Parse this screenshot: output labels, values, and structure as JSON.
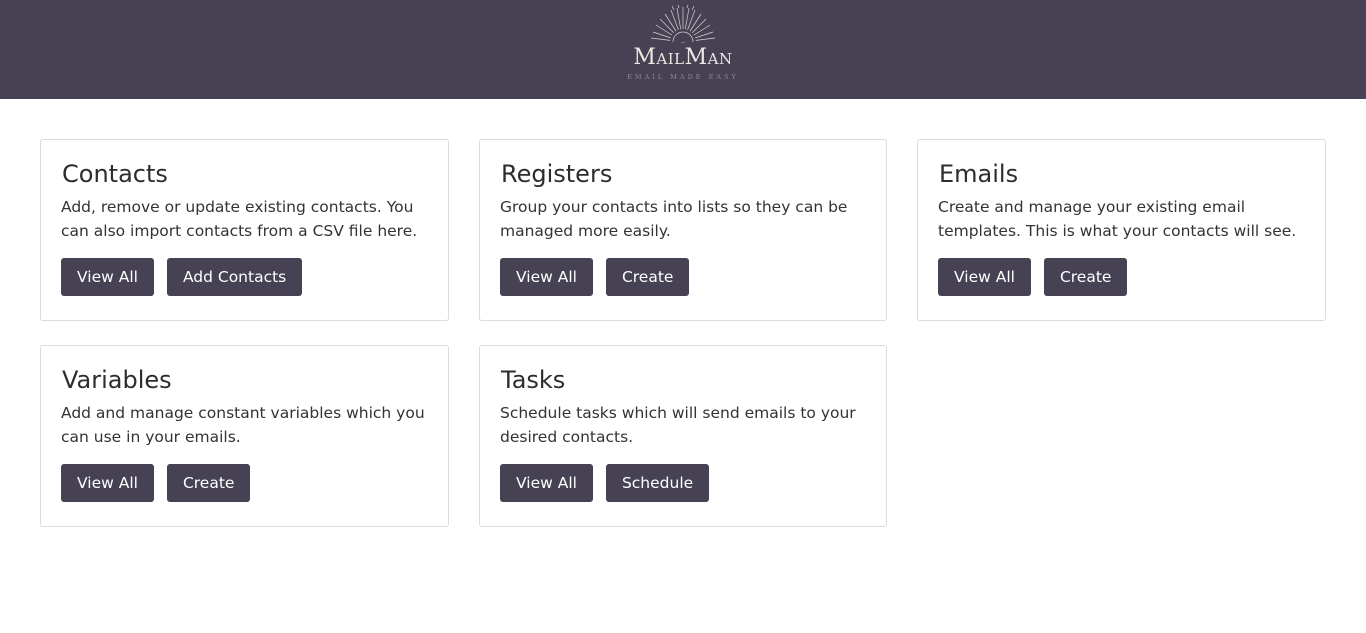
{
  "header": {
    "brand": "MailMan",
    "tagline": "EMAIL MADE EASY"
  },
  "cards": [
    {
      "title": "Contacts",
      "description": "Add, remove or update existing contacts. You can also import contacts from a CSV file here.",
      "buttons": [
        "View All",
        "Add Contacts"
      ]
    },
    {
      "title": "Registers",
      "description": "Group your contacts into lists so they can be managed more easily.",
      "buttons": [
        "View All",
        "Create"
      ]
    },
    {
      "title": "Emails",
      "description": "Create and manage your existing email templates. This is what your contacts will see.",
      "buttons": [
        "View All",
        "Create"
      ]
    },
    {
      "title": "Variables",
      "description": "Add and manage constant variables which you can use in your emails.",
      "buttons": [
        "View All",
        "Create"
      ]
    },
    {
      "title": "Tasks",
      "description": "Schedule tasks which will send emails to your desired contacts.",
      "buttons": [
        "View All",
        "Schedule"
      ]
    }
  ],
  "colors": {
    "header_bg": "#464254",
    "button_bg": "#464254",
    "button_text": "#ffffff",
    "card_border": "#dcdcdc"
  }
}
